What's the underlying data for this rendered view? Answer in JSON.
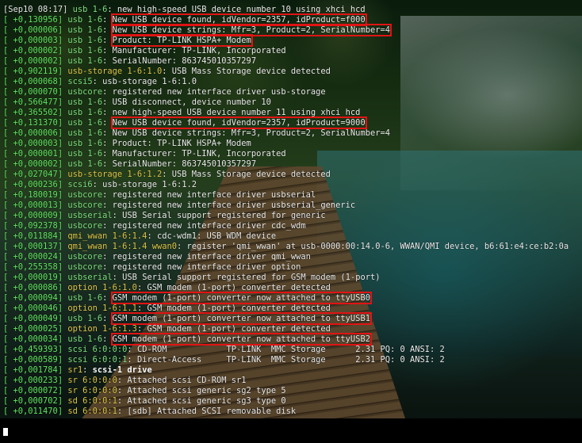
{
  "terminal": {
    "lines": [
      {
        "ts": "[Sep10 08:17]",
        "src": "usb 1-6",
        "msg": "new high-speed USB device number 10 using xhci_hcd"
      },
      {
        "ts": "[ +0,130956]",
        "src": "usb 1-6",
        "msg": "New USB device found, idVendor=2357, idProduct=f000"
      },
      {
        "ts": "[ +0,000006]",
        "src": "usb 1-6",
        "msg": "New USB device strings: Mfr=3, Product=2, SerialNumber=4"
      },
      {
        "ts": "[ +0,000003]",
        "src": "usb 1-6",
        "msg": "Product: TP-LINK HSPA+ Modem"
      },
      {
        "ts": "[ +0,000002]",
        "src": "usb 1-6",
        "msg": "Manufacturer: TP-LINK, Incorporated"
      },
      {
        "ts": "[ +0,000002]",
        "src": "usb 1-6",
        "msg": "SerialNumber: 863745010357297"
      },
      {
        "ts": "[ +0,902119]",
        "src": "usb-storage 1-6:1.0",
        "msg": "USB Mass Storage device detected"
      },
      {
        "ts": "[ +0,000068]",
        "src": "scsi5",
        "msg": "usb-storage 1-6:1.0"
      },
      {
        "ts": "[ +0,000070]",
        "src": "usbcore",
        "msg": "registered new interface driver usb-storage"
      },
      {
        "ts": "[ +0,566477]",
        "src": "usb 1-6",
        "msg": "USB disconnect, device number 10"
      },
      {
        "ts": "[ +0,365502]",
        "src": "usb 1-6",
        "msg": "new high-speed USB device number 11 using xhci_hcd"
      },
      {
        "ts": "[ +0,131370]",
        "src": "usb 1-6",
        "msg": "New USB device found, idVendor=2357, idProduct=9000"
      },
      {
        "ts": "[ +0,000006]",
        "src": "usb 1-6",
        "msg": "New USB device strings: Mfr=3, Product=2, SerialNumber=4"
      },
      {
        "ts": "[ +0,000003]",
        "src": "usb 1-6",
        "msg": "Product: TP-LINK HSPA+ Modem"
      },
      {
        "ts": "[ +0,000001]",
        "src": "usb 1-6",
        "msg": "Manufacturer: TP-LINK, Incorporated"
      },
      {
        "ts": "[ +0,000002]",
        "src": "usb 1-6",
        "msg": "SerialNumber: 863745010357297"
      },
      {
        "ts": "[ +0,027047]",
        "src": "usb-storage 1-6:1.2",
        "msg": "USB Mass Storage device detected"
      },
      {
        "ts": "[ +0,000236]",
        "src": "scsi6",
        "msg": "usb-storage 1-6:1.2"
      },
      {
        "ts": "[ +0,180019]",
        "src": "usbcore",
        "msg": "registered new interface driver usbserial"
      },
      {
        "ts": "[ +0,000013]",
        "src": "usbcore",
        "msg": "registered new interface driver usbserial_generic"
      },
      {
        "ts": "[ +0,000009]",
        "src": "usbserial",
        "msg": "USB Serial support registered for generic"
      },
      {
        "ts": "[ +0,092378]",
        "src": "usbcore",
        "msg": "registered new interface driver cdc_wdm"
      },
      {
        "ts": "[ +0,011884]",
        "src": "qmi_wwan 1-6:1.4",
        "msg": "cdc-wdm1: USB WDM device"
      },
      {
        "ts": "[ +0,000137]",
        "src": "qmi_wwan 1-6:1.4 wwan0",
        "msg": "register 'qmi_wwan' at usb-0000:00:14.0-6, WWAN/QMI device, b6:61:e4:ce:b2:0a"
      },
      {
        "ts": "[ +0,000024]",
        "src": "usbcore",
        "msg": "registered new interface driver qmi_wwan"
      },
      {
        "ts": "[ +0,255358]",
        "src": "usbcore",
        "msg": "registered new interface driver option"
      },
      {
        "ts": "[ +0,000019]",
        "src": "usbserial",
        "msg": "USB Serial support registered for GSM modem (1-port)"
      },
      {
        "ts": "[ +0,000086]",
        "src": "option 1-6:1.0",
        "msg": "GSM modem (1-port) converter detected"
      },
      {
        "ts": "[ +0,000094]",
        "src": "usb 1-6",
        "msg": "GSM modem (1-port) converter now attached to ttyUSB0"
      },
      {
        "ts": "[ +0,000046]",
        "src": "option 1-6:1.1",
        "msg": "GSM modem (1-port) converter detected"
      },
      {
        "ts": "[ +0,000049]",
        "src": "usb 1-6",
        "msg": "GSM modem (1-port) converter now attached to ttyUSB1"
      },
      {
        "ts": "[ +0,000025]",
        "src": "option 1-6:1.3",
        "msg": "GSM modem (1-port) converter detected"
      },
      {
        "ts": "[ +0,000034]",
        "src": "usb 1-6",
        "msg": "GSM modem (1-port) converter now attached to ttyUSB2"
      },
      {
        "ts": "[ +0,459393]",
        "src": "scsi 6:0:0:0",
        "msg": "CD-ROM            TP-LINK  MMC Storage      2.31 PQ: 0 ANSI: 2"
      },
      {
        "ts": "[ +0,000589]",
        "src": "scsi 6:0:0:1",
        "msg": "Direct-Access     TP-LINK  MMC Storage      2.31 PQ: 0 ANSI: 2"
      },
      {
        "ts": "[ +0,001784]",
        "src": "sr1",
        "msg": "scsi-1 drive"
      },
      {
        "ts": "[ +0,000233]",
        "src": "sr 6:0:0:0",
        "msg": "Attached scsi CD-ROM sr1"
      },
      {
        "ts": "[ +0,000072]",
        "src": "sr 6:0:0:0",
        "msg": "Attached scsi generic sg2 type 5"
      },
      {
        "ts": "[ +0,000702]",
        "src": "sd 6:0:0:1",
        "msg": "Attached scsi generic sg3 type 0"
      },
      {
        "ts": "[ +0,011470]",
        "src": "sd 6:0:0:1",
        "msg": "[sdb] Attached SCSI removable disk"
      }
    ],
    "highlighted_lines": [
      1,
      2,
      3,
      11,
      28,
      30,
      32
    ],
    "colors": {
      "timestamp": "#63e763",
      "source": "#7fe07f",
      "source_warning": "#e0c84a",
      "highlight_box": "#e01414"
    }
  }
}
